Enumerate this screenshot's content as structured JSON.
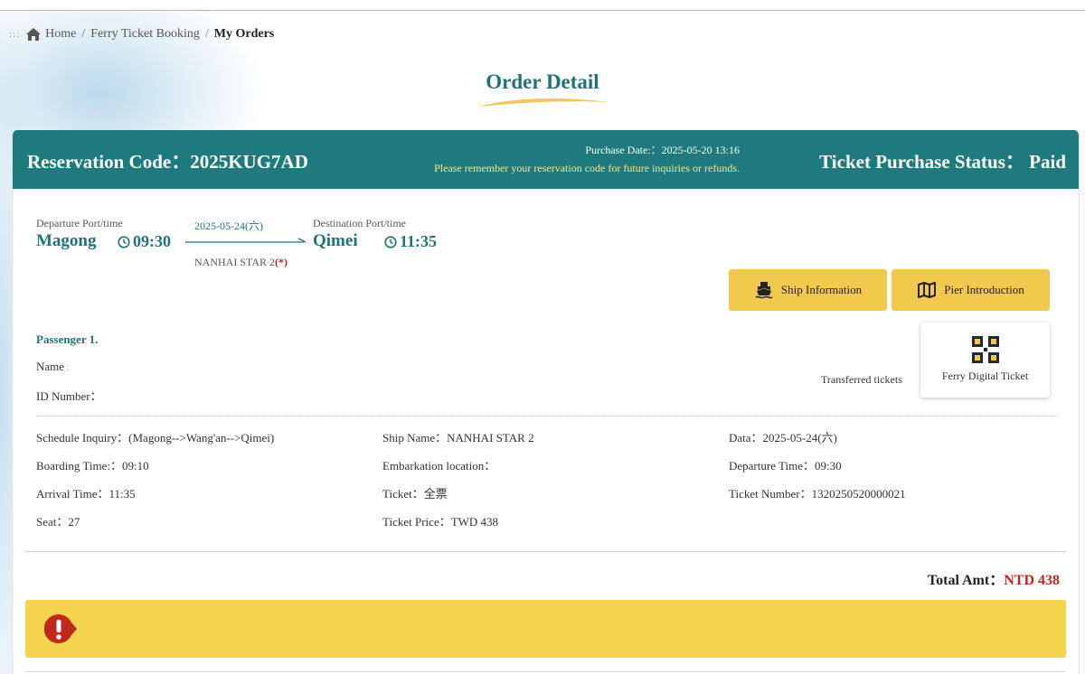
{
  "breadcrumb": {
    "separator_dots": ":::",
    "home": "Home",
    "ferry": "Ferry Ticket Booking",
    "current": "My Orders",
    "sep": "/"
  },
  "page_title": "Order Detail",
  "header": {
    "reservation_code": "Reservation Code：2025KUG7AD",
    "purchase_date": "Purchase Date:：2025-05-20 13:16",
    "remember_note": "Please remember your reservation code for future inquiries or refunds.",
    "status": "Ticket Purchase Status： Paid"
  },
  "route": {
    "departure_label": "Departure Port/time",
    "departure_port": "Magong",
    "departure_time": "09:30",
    "date": "2025-05-24(六)",
    "ship": "NANHAI STAR 2",
    "ship_required_mark": "(*)",
    "destination_label": "Destination Port/time",
    "destination_port": "Qimei",
    "destination_time": "11:35"
  },
  "buttons": {
    "ship_info": "Ship Information",
    "pier_intro": "Pier Introduction",
    "digital_ticket": "Ferry Digital Ticket",
    "transferred": "Transferred tickets"
  },
  "passenger": {
    "title": "Passenger 1.",
    "name_label": "Name",
    "name_sep": ":",
    "id_label": "ID Number："
  },
  "details": {
    "col1": [
      "Schedule Inquiry：(Magong-->Wang'an-->Qimei)",
      "Boarding Time:：09:10",
      "Arrival Time：11:35",
      "Seat：27"
    ],
    "col2": [
      "Ship Name：NANHAI STAR 2",
      "Embarkation location：",
      "Ticket：全票",
      "Ticket Price：TWD 438"
    ],
    "col3": [
      "Data：2025-05-24(六)",
      "Departure Time：09:30",
      "Ticket Number：1320250520000021"
    ]
  },
  "total": {
    "label": "Total Amt：",
    "amount": "NTD 438"
  },
  "icons": {
    "home": "home-icon",
    "clock": "clock-icon",
    "ship": "ship-icon",
    "map": "map-icon",
    "qr": "qr-code-icon",
    "alert": "alert-icon"
  },
  "colors": {
    "header_bg": "#1e7a7c",
    "accent": "#1f7378",
    "button_yellow": "#f2c94c",
    "notice_yellow": "#f6d54e",
    "alert_red": "#c0281c"
  }
}
